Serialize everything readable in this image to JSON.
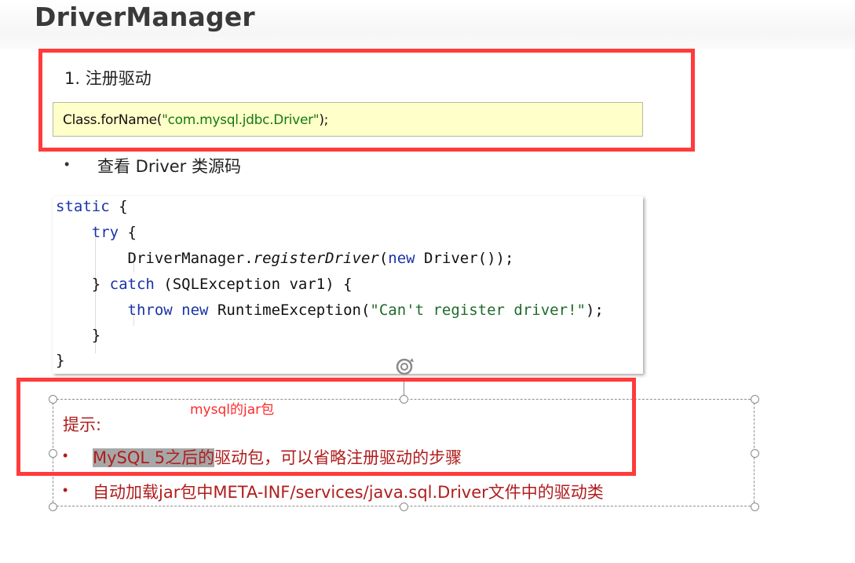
{
  "slide": {
    "title": "DriverManager"
  },
  "step": {
    "heading": "1.  注册驱动",
    "code_prefix": "Class.forName(",
    "code_string": "\"com.mysql.jdbc.Driver\"",
    "code_suffix": ");"
  },
  "bullet": {
    "symbol": "•",
    "text": "查看 Driver 类源码"
  },
  "code_block": {
    "l1_kw": "static",
    "l1_rest": " {",
    "l2_kw": "try",
    "l2_rest": " {",
    "l3_a": "DriverManager.",
    "l3_method": "registerDriver",
    "l3_b": "(",
    "l3_kw": "new",
    "l3_c": " Driver());",
    "l4_a": "} ",
    "l4_kw": "catch",
    "l4_b": " (SQLException var1) {",
    "l5_kw1": "throw",
    "l5_sp": " ",
    "l5_kw2": "new",
    "l5_a": " RuntimeException(",
    "l5_str": "\"Can't register driver!\"",
    "l5_b": ");",
    "l6": "}",
    "l7": "}"
  },
  "annotation": {
    "text": "mysql的jar包"
  },
  "tips": {
    "label": "提示:",
    "bullet_symbol": "•",
    "item1_highlighted": "MySQL 5之后的",
    "item1_rest": "驱动包，可以省略注册驱动的步骤",
    "item2": "自动加载jar包中META-INF/services/java.sql.Driver文件中的驱动类"
  },
  "icons": {
    "rotate": "rotate-handle-icon"
  },
  "colors": {
    "annotation_red": "#ff3b3b",
    "tip_text": "#b01d1d",
    "code_string": "#157a15",
    "code_keyword": "#1a33a8",
    "code_highlight_bg": "#ffffc9"
  }
}
